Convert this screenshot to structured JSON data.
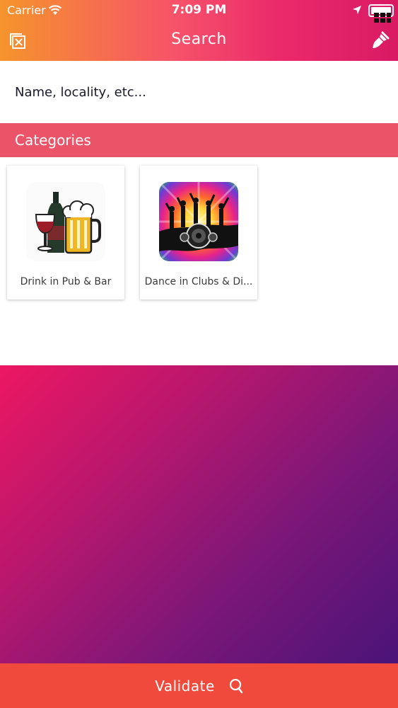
{
  "status_bar": {
    "carrier": "Carrier",
    "time": "7:09 PM"
  },
  "nav": {
    "title": "Search",
    "left_icon": "clear-filter-icon",
    "right_icon": "brush-icon"
  },
  "search": {
    "placeholder": "Name, locality, etc..."
  },
  "categories": {
    "header": "Categories",
    "items": [
      {
        "label": "Drink in Pub & Bar",
        "icon": "drinks-icon"
      },
      {
        "label": "Dance in Clubs & Di...",
        "icon": "dance-club-icon"
      }
    ]
  },
  "footer": {
    "validate_label": "Validate",
    "icon": "search-icon"
  },
  "colors": {
    "header_gradient_start": "#f5942c",
    "header_gradient_end": "#d91a63",
    "categories_header": "#ea5368",
    "bottom_bar": "#ef4a3c",
    "body_gradient_start": "#ed1762",
    "body_gradient_end": "#4a1478"
  }
}
